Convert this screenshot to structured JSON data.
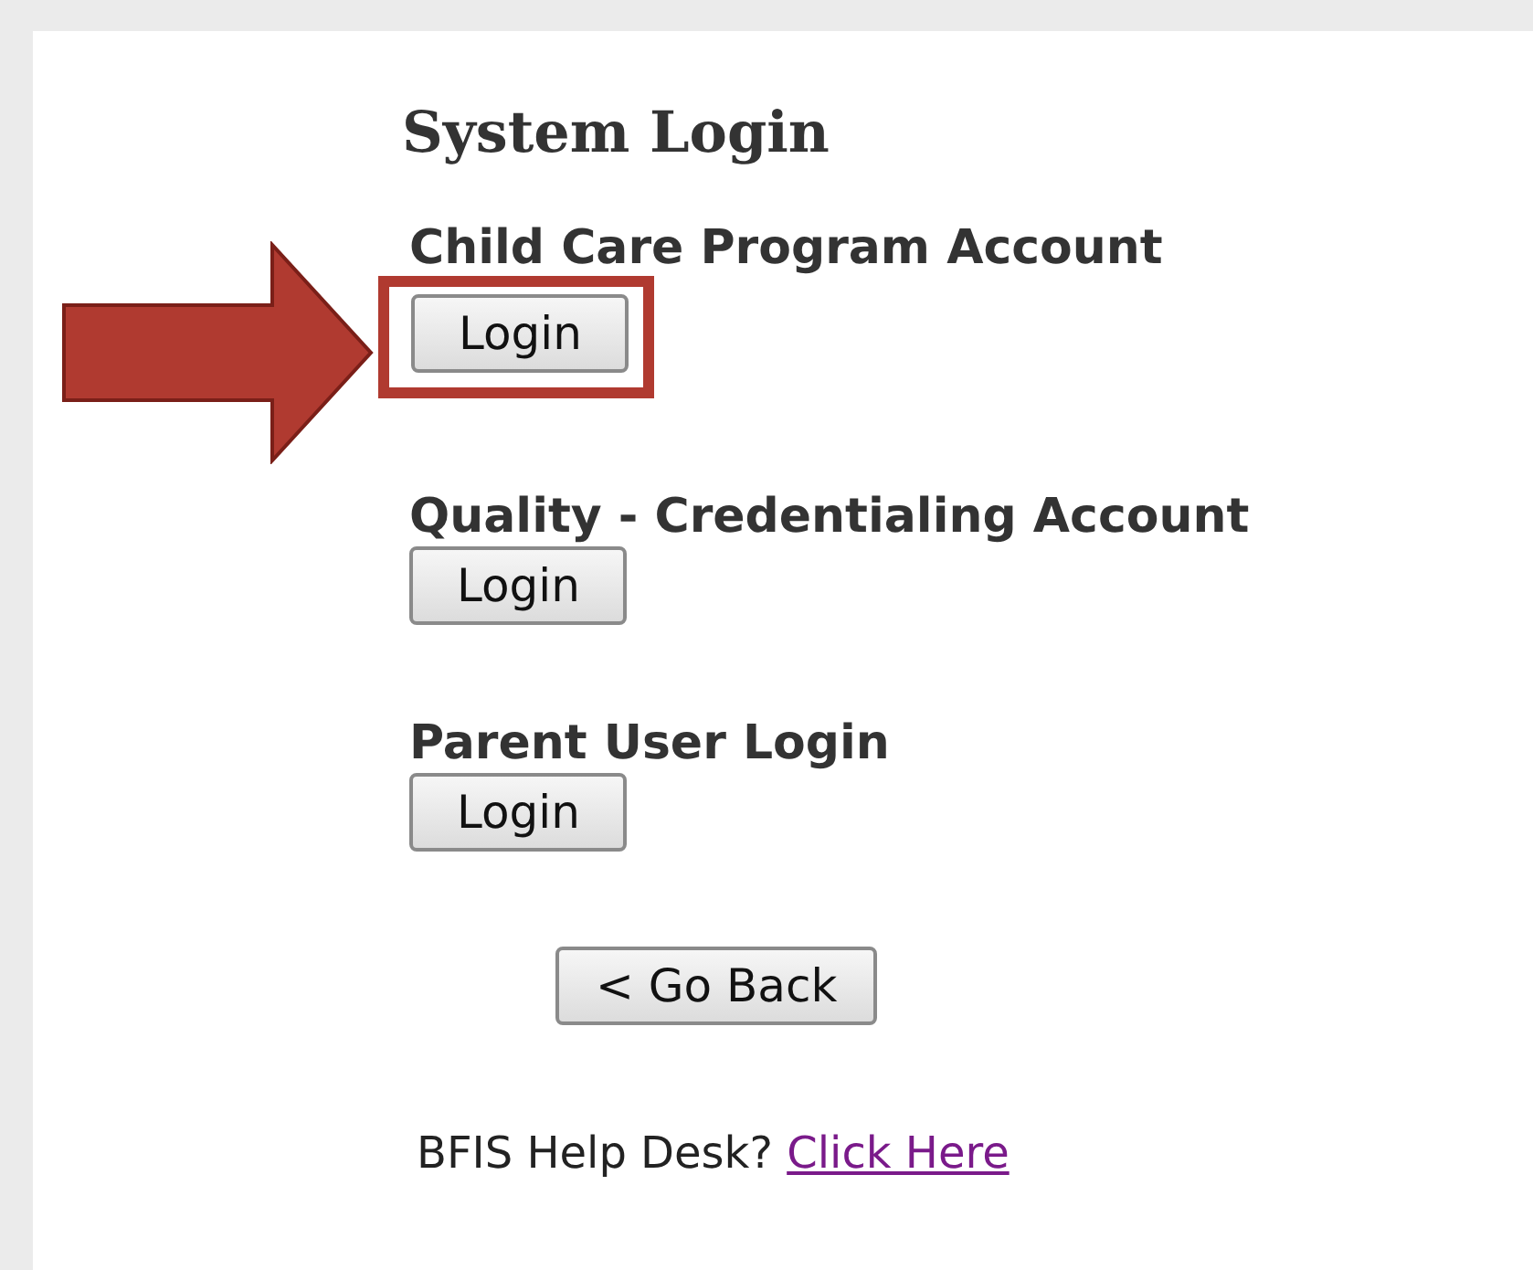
{
  "title": "System Login",
  "accounts": [
    {
      "label": "Child Care Program Account",
      "button": "Login",
      "highlighted": true
    },
    {
      "label": "Quality - Credentialing Account",
      "button": "Login",
      "highlighted": false
    },
    {
      "label": "Parent User Login",
      "button": "Login",
      "highlighted": false
    }
  ],
  "back_button": "< Go Back",
  "help": {
    "text": "BFIS Help Desk?",
    "link": "Click Here"
  }
}
